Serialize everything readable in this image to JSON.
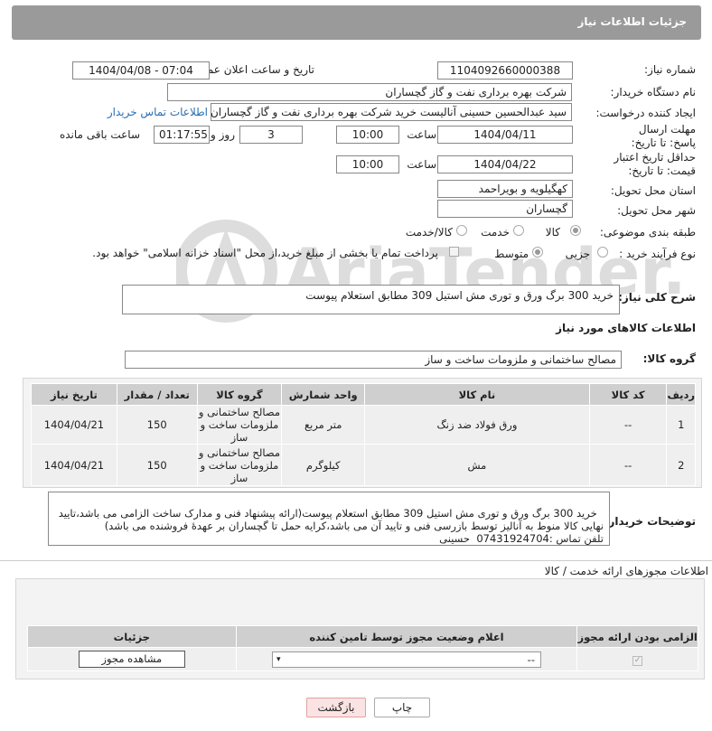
{
  "header": {
    "title": "جزئیات اطلاعات نیاز"
  },
  "form": {
    "need_number_label": "شماره نیاز:",
    "need_number": "1104092660000388",
    "announce_label": "تاریخ و ساعت اعلان عمومی:",
    "announce_value": "1404/04/08 - 07:04",
    "buyer_org_label": "نام دستگاه خریدار:",
    "buyer_org": "شرکت بهره برداری نفت و گاز گچساران",
    "creator_label": "ایجاد کننده درخواست:",
    "creator": "سید عبدالحسین حسینی آنالیست خرید شرکت بهره برداری نفت و گاز گچساران",
    "contact_link": "اطلاعات تماس خریدار",
    "deadline_label": "مهلت ارسال پاسخ: تا تاریخ:",
    "deadline_date": "1404/04/11",
    "time_label": "ساعت",
    "deadline_time": "10:00",
    "days": "3",
    "days_label": "روز و",
    "remaining_time": "01:17:55",
    "remaining_label": "ساعت باقی مانده",
    "validity_label": "حداقل تاریخ اعتبار قیمت: تا تاریخ:",
    "validity_date": "1404/04/22",
    "validity_time": "10:00",
    "province_label": "استان محل تحویل:",
    "province": "کهگیلویه و بویراحمد",
    "city_label": "شهر محل تحویل:",
    "city": "گچساران",
    "category_label": "طبقه بندی موضوعی:",
    "category_options": [
      "کالا",
      "خدمت",
      "کالا/خدمت"
    ],
    "process_label": "نوع فرآیند خرید :",
    "process_options": [
      "جزیی",
      "متوسط"
    ],
    "payment_note": "پرداخت تمام یا بخشی از مبلغ خرید،از محل \"اسناد خزانه اسلامی\" خواهد بود."
  },
  "summary": {
    "label": "شرح کلی نیاز:",
    "text": "خرید 300 برگ ورق و توری مش استیل 309 مطابق استعلام پیوست"
  },
  "goods": {
    "section_title": "اطلاعات کالاهای مورد نیاز",
    "group_label": "گروه کالا:",
    "group_value": "مصالح ساختمانی و ملزومات ساخت و ساز",
    "columns": [
      "ردیف",
      "کد کالا",
      "نام کالا",
      "واحد شمارش",
      "گروه کالا",
      "تعداد / مقدار",
      "تاریخ نیاز"
    ],
    "rows": [
      {
        "idx": "1",
        "code": "--",
        "name": "ورق فولاد ضد زنگ",
        "unit": "متر مربع",
        "group": "مصالح ساختمانی و ملزومات ساخت و ساز",
        "qty": "150",
        "date": "1404/04/21"
      },
      {
        "idx": "2",
        "code": "--",
        "name": "مش",
        "unit": "کیلوگرم",
        "group": "مصالح ساختمانی و ملزومات ساخت و ساز",
        "qty": "150",
        "date": "1404/04/21"
      }
    ]
  },
  "buyer_notes": {
    "label": "توضیحات خریدار:",
    "text": "خرید 300 برگ ورق و توری مش استیل 309 مطابق استعلام پیوست(ارائه پیشنهاد فنی و مدارک ساخت الزامی می باشد،تایید نهایی کالا منوط به آنالیز توسط بازرسی فنی و تایید آن می باشد،کرایه حمل تا گچساران بر عهدهٔ فروشنده می باشد)\nتلفن تماس :07431924704  حسینی"
  },
  "permits": {
    "section_title": "اطلاعات مجوزهای ارائه خدمت / کالا",
    "columns": [
      "الزامی بودن ارائه مجوز",
      "اعلام وضعیت مجوز توسط تامین کننده",
      "جزئیات"
    ],
    "select_value": "--",
    "view_button": "مشاهده مجوز"
  },
  "footer": {
    "print": "چاپ",
    "back": "بازگشت"
  },
  "watermark": "AriaTender.net"
}
